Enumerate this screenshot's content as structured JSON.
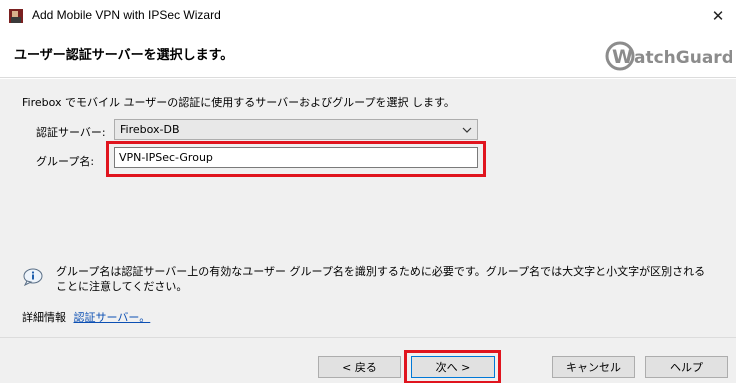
{
  "window": {
    "title": "Add Mobile VPN with IPSec Wizard",
    "close_glyph": "✕"
  },
  "header": {
    "title": "ユーザー認証サーバーを選択します。",
    "logo_text": "WatchGuard",
    "logo_color": "#8c8c8c"
  },
  "main": {
    "intro": "Firebox でモバイル ユーザーの認証に使用するサーバーおよびグループを選択 します。",
    "auth_server_label": "認証サーバー:",
    "auth_server_value": "Firebox-DB",
    "group_label": "グループ名:",
    "group_value": "VPN-IPSec-Group",
    "info_text_line1": "グループ名は認証サーバー上の有効なユーザー グループ名を識別するために必要です。グループ名では大文字と小文字が区別される",
    "info_text_line2": "ことに注意してください。",
    "more_info_label": "詳細情報",
    "more_info_link": "認証サーバー。"
  },
  "footer": {
    "back_label": "< 戻る",
    "next_label": "次へ >",
    "cancel_label": "キャンセル",
    "help_label": "ヘルプ"
  },
  "colors": {
    "highlight": "#e0141e",
    "link": "#0b4fb3"
  }
}
